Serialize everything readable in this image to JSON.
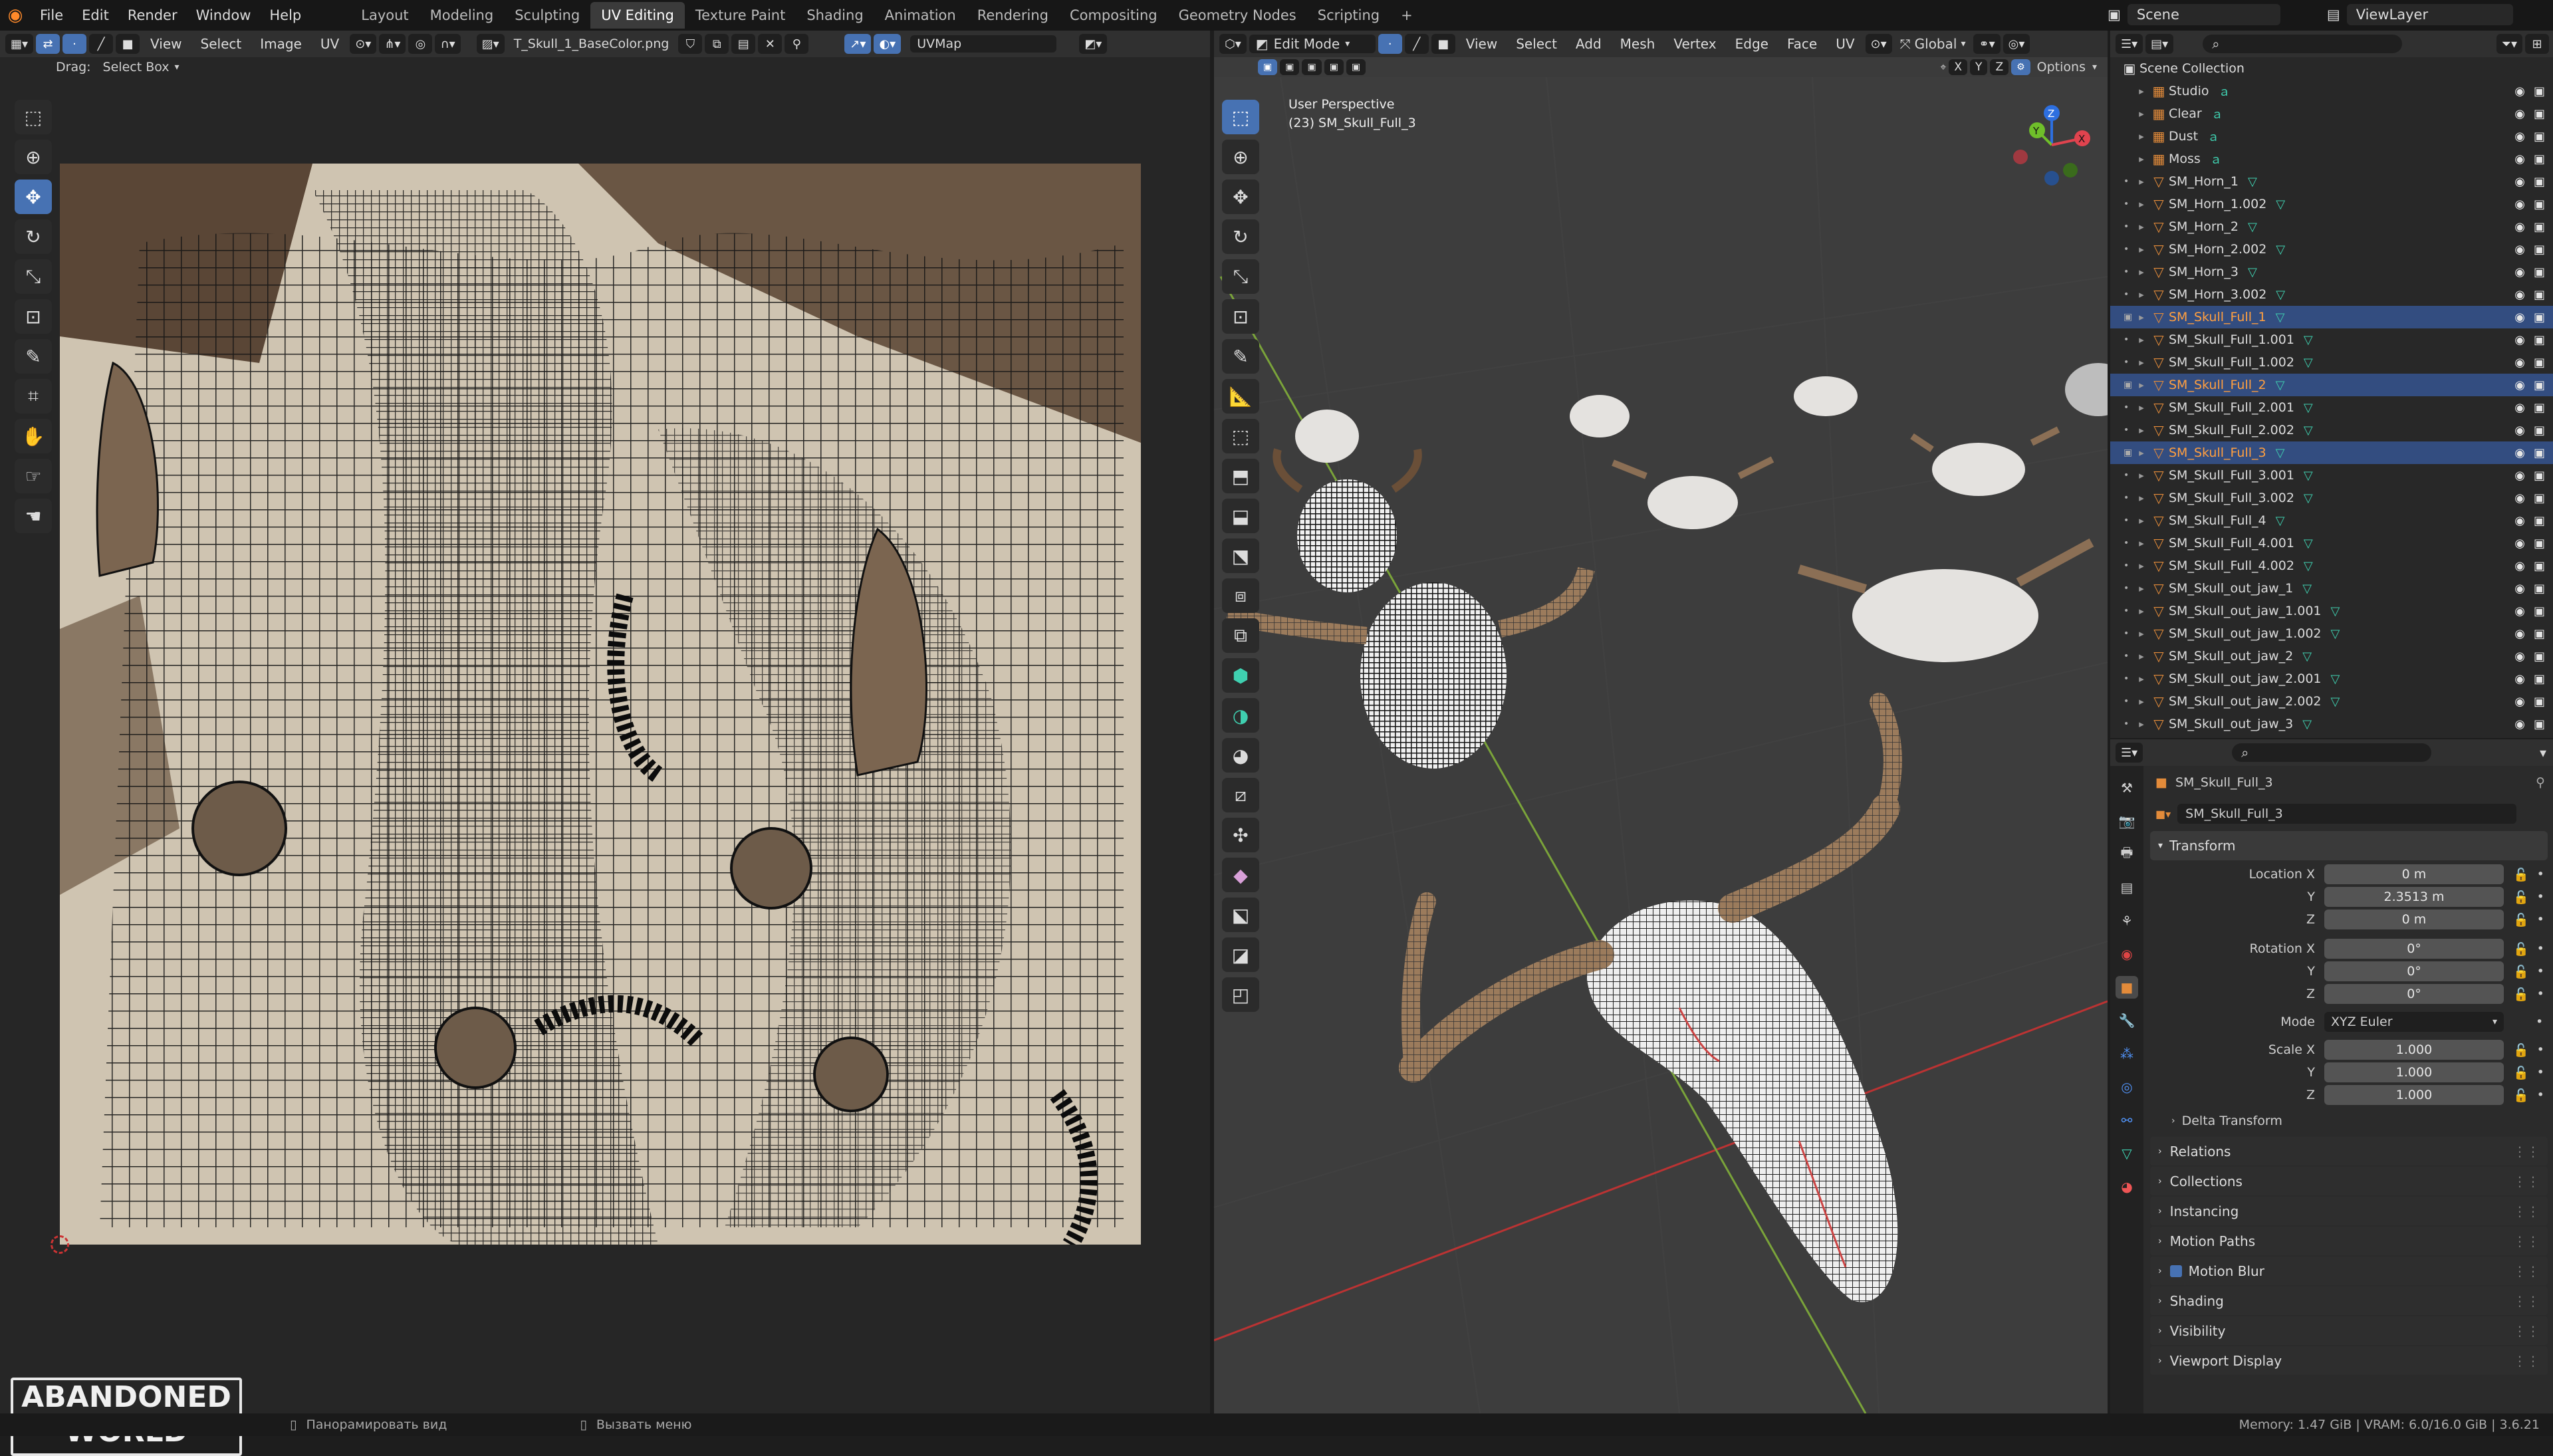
{
  "topbar": {
    "menus": [
      "File",
      "Edit",
      "Render",
      "Window",
      "Help"
    ],
    "workspaces": [
      "Layout",
      "Modeling",
      "Sculpting",
      "UV Editing",
      "Texture Paint",
      "Shading",
      "Animation",
      "Rendering",
      "Compositing",
      "Geometry Nodes",
      "Scripting"
    ],
    "active_workspace": "UV Editing",
    "add_tab": "+",
    "scene": "Scene",
    "view_layer": "ViewLayer"
  },
  "uv_editor": {
    "menus": [
      "View",
      "Select",
      "Image",
      "UV"
    ],
    "image_name": "T_Skull_1_BaseColor.png",
    "uvmap": "UVMap",
    "drag_label": "Drag:",
    "drag_value": "Select Box"
  },
  "viewport": {
    "mode": "Edit Mode",
    "menus": [
      "View",
      "Select",
      "Add",
      "Mesh",
      "Vertex",
      "Edge",
      "Face",
      "UV"
    ],
    "orientation": "Global",
    "options": "Options",
    "axes": [
      "X",
      "Y",
      "Z"
    ],
    "view_name": "User Perspective",
    "object_label": "(23) SM_Skull_Full_3"
  },
  "outliner": {
    "root": "Scene Collection",
    "items": [
      {
        "name": "Studio",
        "type": "collection"
      },
      {
        "name": "Clear",
        "type": "collection"
      },
      {
        "name": "Dust",
        "type": "collection"
      },
      {
        "name": "Moss",
        "type": "collection"
      },
      {
        "name": "SM_Horn_1",
        "type": "mesh"
      },
      {
        "name": "SM_Horn_1.002",
        "type": "mesh"
      },
      {
        "name": "SM_Horn_2",
        "type": "mesh"
      },
      {
        "name": "SM_Horn_2.002",
        "type": "mesh"
      },
      {
        "name": "SM_Horn_3",
        "type": "mesh"
      },
      {
        "name": "SM_Horn_3.002",
        "type": "mesh"
      },
      {
        "name": "SM_Skull_Full_1",
        "type": "mesh",
        "selected": true
      },
      {
        "name": "SM_Skull_Full_1.001",
        "type": "mesh"
      },
      {
        "name": "SM_Skull_Full_1.002",
        "type": "mesh"
      },
      {
        "name": "SM_Skull_Full_2",
        "type": "mesh",
        "selected": true
      },
      {
        "name": "SM_Skull_Full_2.001",
        "type": "mesh"
      },
      {
        "name": "SM_Skull_Full_2.002",
        "type": "mesh"
      },
      {
        "name": "SM_Skull_Full_3",
        "type": "mesh",
        "selected": true
      },
      {
        "name": "SM_Skull_Full_3.001",
        "type": "mesh"
      },
      {
        "name": "SM_Skull_Full_3.002",
        "type": "mesh"
      },
      {
        "name": "SM_Skull_Full_4",
        "type": "mesh"
      },
      {
        "name": "SM_Skull_Full_4.001",
        "type": "mesh"
      },
      {
        "name": "SM_Skull_Full_4.002",
        "type": "mesh"
      },
      {
        "name": "SM_Skull_out_jaw_1",
        "type": "mesh"
      },
      {
        "name": "SM_Skull_out_jaw_1.001",
        "type": "mesh"
      },
      {
        "name": "SM_Skull_out_jaw_1.002",
        "type": "mesh"
      },
      {
        "name": "SM_Skull_out_jaw_2",
        "type": "mesh"
      },
      {
        "name": "SM_Skull_out_jaw_2.001",
        "type": "mesh"
      },
      {
        "name": "SM_Skull_out_jaw_2.002",
        "type": "mesh"
      },
      {
        "name": "SM_Skull_out_jaw_3",
        "type": "mesh"
      }
    ]
  },
  "properties": {
    "object_name": "SM_Skull_Full_3",
    "object_field": "SM_Skull_Full_3",
    "transform_title": "Transform",
    "location": {
      "x": "0 m",
      "y": "2.3513 m",
      "z": "0 m"
    },
    "rotation": {
      "x": "0°",
      "y": "0°",
      "z": "0°"
    },
    "mode_label": "Mode",
    "mode_value": "XYZ Euler",
    "scale": {
      "x": "1.000",
      "y": "1.000",
      "z": "1.000"
    },
    "labels": {
      "location_x": "Location X",
      "rotation_x": "Rotation X",
      "scale_x": "Scale X",
      "y": "Y",
      "z": "Z"
    },
    "delta": "Delta Transform",
    "sections": [
      "Relations",
      "Collections",
      "Instancing",
      "Motion Paths",
      "Motion Blur",
      "Shading",
      "Visibility",
      "Viewport Display"
    ]
  },
  "statusbar": {
    "pan": "Панорамировать вид",
    "menu": "Вызвать меню",
    "memory": "Memory: 1.47 GiB | VRAM: 6.0/16.0 GiB | 3.6.21"
  },
  "watermark": {
    "line1": "ABANDONED",
    "line2": "WORLD"
  },
  "colors": {
    "accent": "#4772b3",
    "selected_row": "#334d80",
    "active_name": "#ff9f40",
    "mesh_icon": "#3fd0b0",
    "object_icon": "#e38b3a"
  }
}
